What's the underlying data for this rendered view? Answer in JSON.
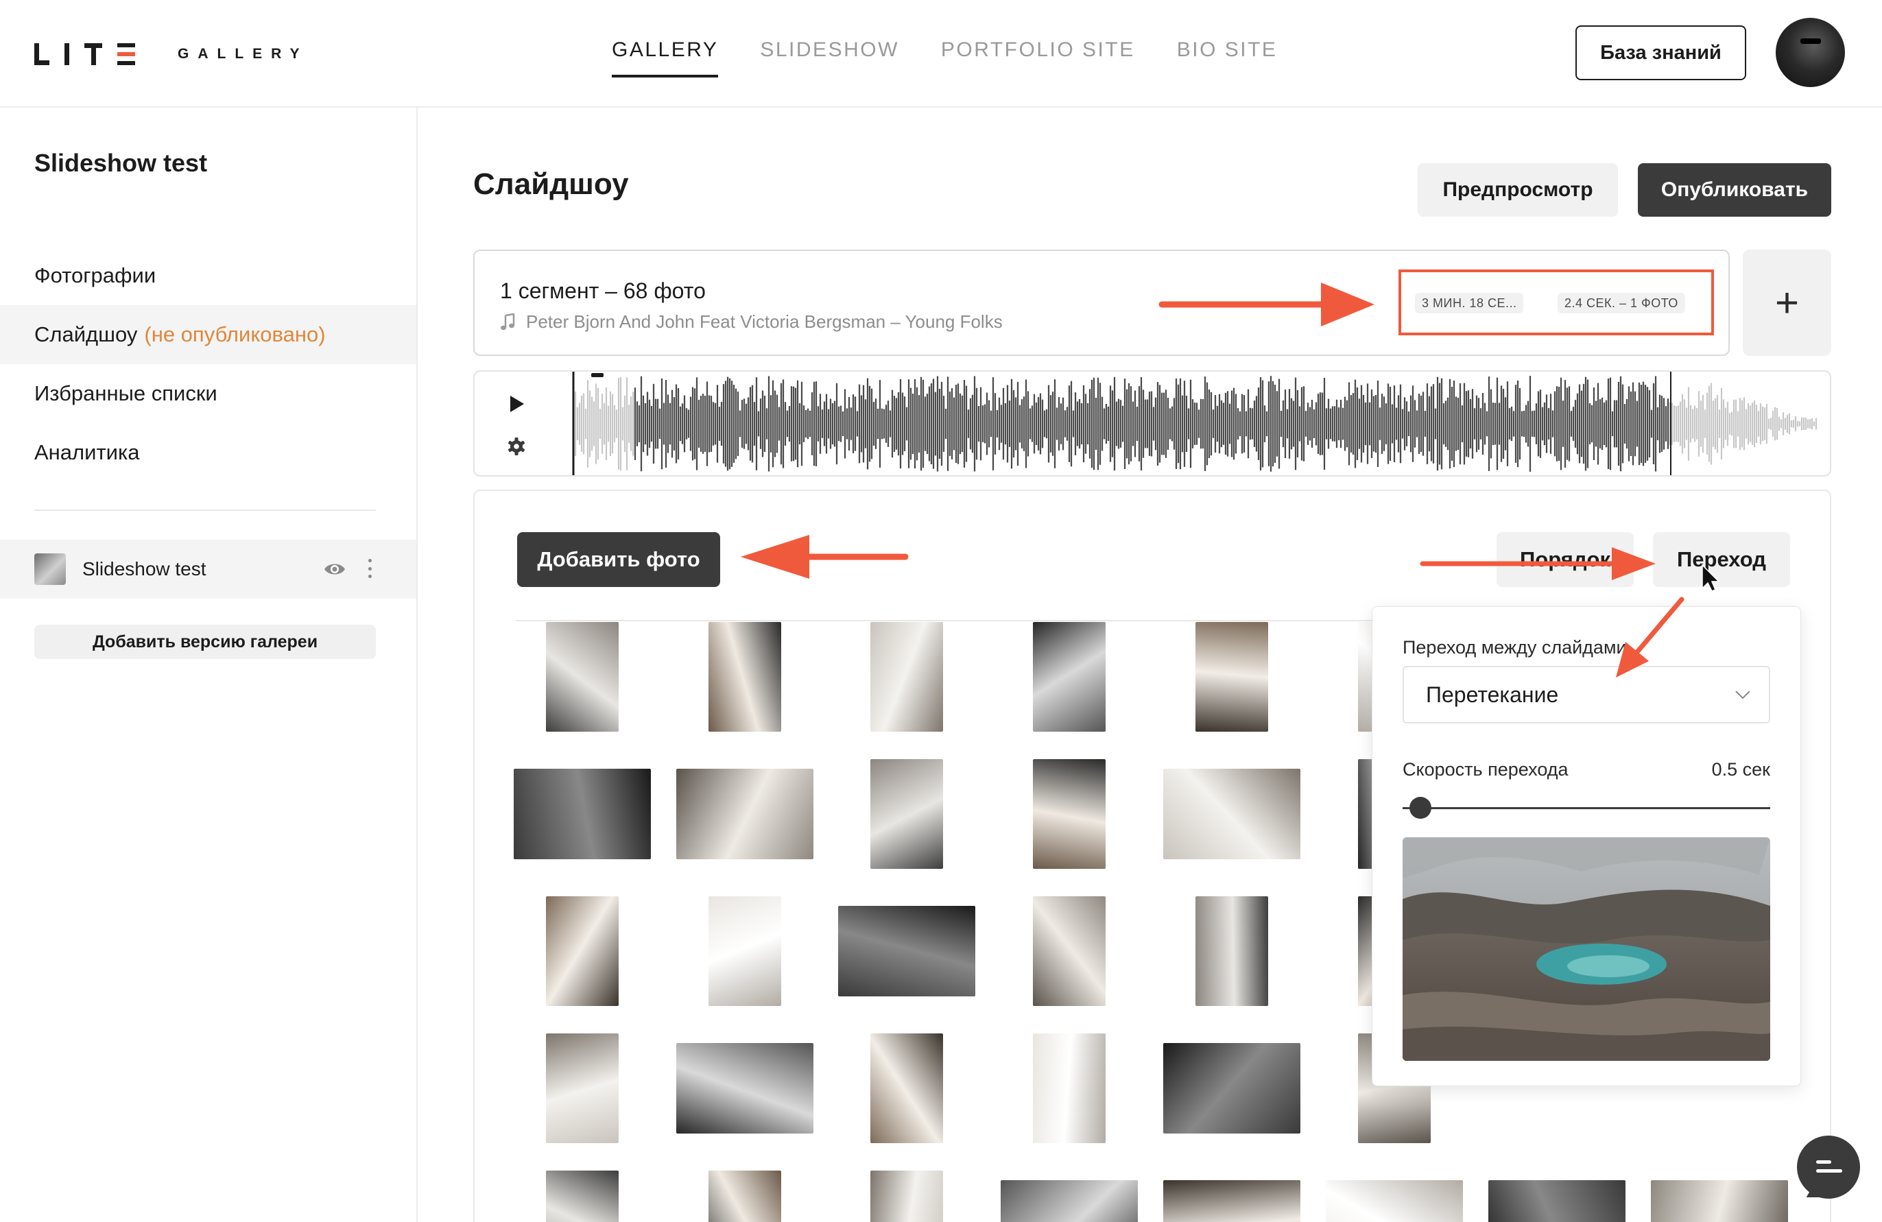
{
  "header": {
    "logo_text": "GALLERY",
    "nav": [
      {
        "label": "GALLERY",
        "active": true
      },
      {
        "label": "SLIDESHOW",
        "active": false
      },
      {
        "label": "PORTFOLIO SITE",
        "active": false
      },
      {
        "label": "BIO SITE",
        "active": false
      }
    ],
    "knowledge_base_label": "База знаний"
  },
  "sidebar": {
    "title": "Slideshow test",
    "menu": [
      {
        "label": "Фотографии",
        "status": ""
      },
      {
        "label": "Слайдшоу",
        "status": "(не опубликовано)"
      },
      {
        "label": "Избранные списки",
        "status": ""
      },
      {
        "label": "Аналитика",
        "status": ""
      }
    ],
    "gallery_version_name": "Slideshow test",
    "add_version_label": "Добавить версию галереи"
  },
  "main": {
    "title": "Слайдшоу",
    "preview_label": "Предпросмотр",
    "publish_label": "Опубликовать",
    "segment": {
      "title": "1 сегмент – 68 фото",
      "track": "Peter Bjorn And John Feat Victoria Bergsman – Young Folks",
      "duration_badge": "3 МИН. 18 СЕ...",
      "timing_badge": "2.4 СЕК. – 1 ФОТО"
    },
    "add_segment_label": "+",
    "add_photo_label": "Добавить фото",
    "order_label": "Порядок",
    "transition_label": "Переход"
  },
  "transition_popup": {
    "label": "Переход между слайдами",
    "selected": "Перетекание",
    "speed_label": "Скорость перехода",
    "speed_value": "0.5 сек",
    "speed_fraction": 0.02
  },
  "colors": {
    "accent": "#f05a3c",
    "status_orange": "#e0873a",
    "dark_button": "#3b3b3b",
    "light_button": "#f1f1f1"
  },
  "icons": {
    "play": "play-icon",
    "settings": "gear-icon",
    "eye": "eye-icon",
    "more": "more-vertical-icon",
    "chevron": "chevron-down-icon",
    "chat": "chat-icon",
    "music": "music-note-icon"
  }
}
